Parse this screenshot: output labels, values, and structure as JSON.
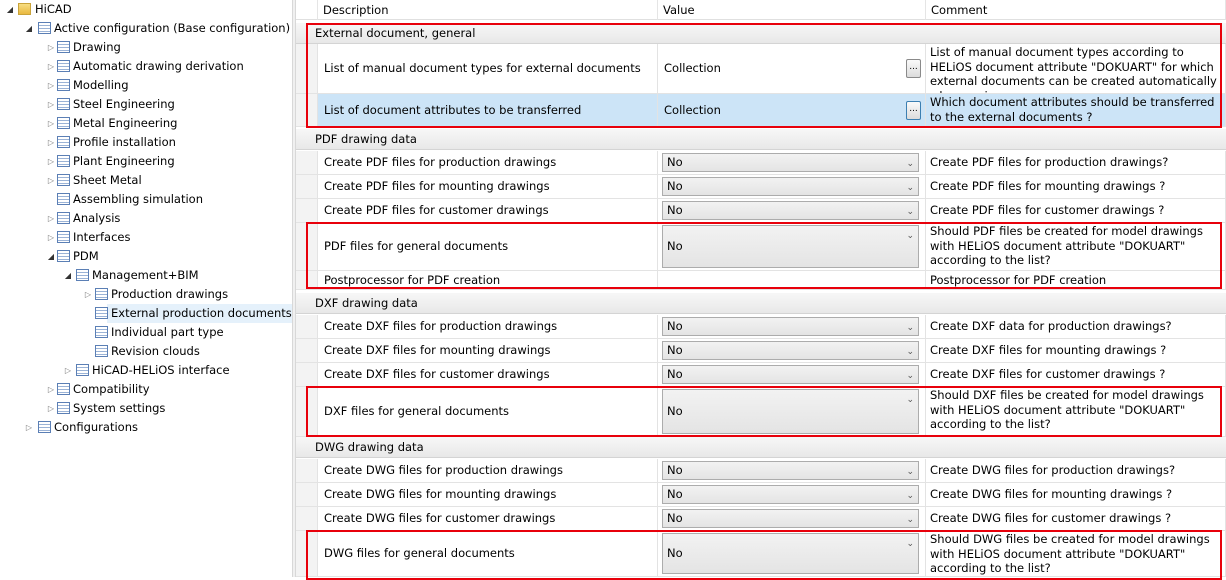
{
  "tree": [
    {
      "label": "HiCAD",
      "level": 0,
      "arrow": "open",
      "icon": "folder"
    },
    {
      "label": "Active configuration (Base configuration)",
      "level": 1,
      "arrow": "open",
      "icon": "list"
    },
    {
      "label": "Drawing",
      "level": 2,
      "arrow": "closed",
      "icon": "table"
    },
    {
      "label": "Automatic drawing derivation",
      "level": 2,
      "arrow": "closed",
      "icon": "table"
    },
    {
      "label": "Modelling",
      "level": 2,
      "arrow": "closed",
      "icon": "table"
    },
    {
      "label": "Steel Engineering",
      "level": 2,
      "arrow": "closed",
      "icon": "table"
    },
    {
      "label": "Metal Engineering",
      "level": 2,
      "arrow": "closed",
      "icon": "table"
    },
    {
      "label": "Profile installation",
      "level": 2,
      "arrow": "closed",
      "icon": "table"
    },
    {
      "label": "Plant Engineering",
      "level": 2,
      "arrow": "closed",
      "icon": "table"
    },
    {
      "label": "Sheet Metal",
      "level": 2,
      "arrow": "closed",
      "icon": "table"
    },
    {
      "label": "Assembling simulation",
      "level": 2,
      "arrow": "none",
      "icon": "table"
    },
    {
      "label": "Analysis",
      "level": 2,
      "arrow": "closed",
      "icon": "table"
    },
    {
      "label": "Interfaces",
      "level": 2,
      "arrow": "closed",
      "icon": "table"
    },
    {
      "label": "PDM",
      "level": 2,
      "arrow": "open",
      "icon": "table"
    },
    {
      "label": "Management+BIM",
      "level": 3,
      "arrow": "open",
      "icon": "table"
    },
    {
      "label": "Production drawings",
      "level": 4,
      "arrow": "closed",
      "icon": "table"
    },
    {
      "label": "External production documents",
      "level": 4,
      "arrow": "none",
      "icon": "table",
      "selected": true
    },
    {
      "label": "Individual part type",
      "level": 4,
      "arrow": "none",
      "icon": "table"
    },
    {
      "label": "Revision clouds",
      "level": 4,
      "arrow": "none",
      "icon": "table"
    },
    {
      "label": "HiCAD-HELiOS interface",
      "level": 3,
      "arrow": "closed",
      "icon": "table"
    },
    {
      "label": "Compatibility",
      "level": 2,
      "arrow": "closed",
      "icon": "table"
    },
    {
      "label": "System settings",
      "level": 2,
      "arrow": "closed",
      "icon": "table"
    },
    {
      "label": "Configurations",
      "level": 1,
      "arrow": "closed",
      "icon": "list"
    }
  ],
  "grid": {
    "headers": [
      "Description",
      "Value",
      "Comment"
    ],
    "groups": [
      {
        "title": "External document, general",
        "rows": [
          {
            "desc": "List of manual document types for external documents",
            "value": "Collection",
            "type": "button",
            "comment": "List of manual document types according to HELiOS document attribute \"DOKUART\" for which external documents can be created automatically when saving"
          },
          {
            "desc": "List of document attributes to be transferred",
            "value": "Collection",
            "type": "button",
            "selected": true,
            "comment": "Which document attributes should be transferred to the external documents ?"
          }
        ]
      },
      {
        "title": "PDF drawing data",
        "rows": [
          {
            "desc": "Create PDF files for production drawings",
            "value": "No",
            "type": "select",
            "comment": "Create PDF files for production drawings?"
          },
          {
            "desc": "Create PDF files for mounting drawings",
            "value": "No",
            "type": "select",
            "comment": "Create PDF files for mounting drawings ?"
          },
          {
            "desc": "Create PDF files for customer drawings",
            "value": "No",
            "type": "select",
            "comment": "Create PDF files for customer drawings ?"
          },
          {
            "desc": "PDF files for general documents",
            "value": "No",
            "type": "select",
            "comment": "Should PDF files be created for model drawings with HELiOS document attribute \"DOKUART\" according to the list?"
          },
          {
            "desc": "Postprocessor for PDF creation",
            "value": "",
            "type": "text",
            "comment": "Postprocessor for PDF creation"
          }
        ]
      },
      {
        "title": "DXF drawing data",
        "rows": [
          {
            "desc": "Create DXF files for production drawings",
            "value": "No",
            "type": "select",
            "comment": "Create DXF data for production drawings?"
          },
          {
            "desc": "Create DXF files for mounting drawings",
            "value": "No",
            "type": "select",
            "comment": "Create DXF files for mounting drawings ?"
          },
          {
            "desc": "Create DXF files for customer drawings",
            "value": "No",
            "type": "select",
            "comment": "Create DXF files for customer drawings ?"
          },
          {
            "desc": "DXF files for general documents",
            "value": "No",
            "type": "select",
            "comment": "Should DXF files be created for model drawings with HELiOS document attribute \"DOKUART\" according to the list?"
          }
        ]
      },
      {
        "title": "DWG drawing data",
        "rows": [
          {
            "desc": "Create DWG files for production drawings",
            "value": "No",
            "type": "select",
            "comment": "Create DWG files for production drawings?"
          },
          {
            "desc": "Create DWG files for mounting drawings",
            "value": "No",
            "type": "select",
            "comment": "Create DWG files for mounting drawings ?"
          },
          {
            "desc": "Create DWG files for customer drawings",
            "value": "No",
            "type": "select",
            "comment": "Create DWG files for customer drawings ?"
          },
          {
            "desc": "DWG files for general documents",
            "value": "No",
            "type": "select",
            "comment": "Should DWG files be created for model drawings with HELiOS document attribute \"DOKUART\" according to the list?"
          }
        ]
      }
    ]
  },
  "colors": {
    "highlight": "#e8000b",
    "selected_row": "#cce4f7"
  }
}
